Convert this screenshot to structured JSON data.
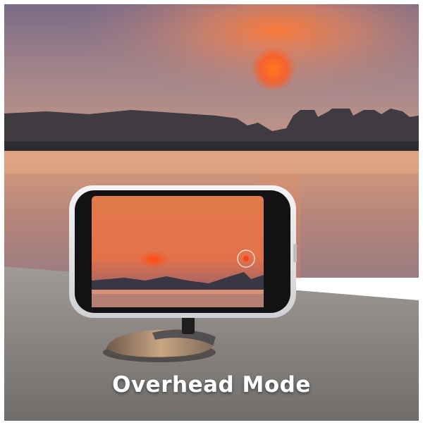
{
  "caption": "Overhead Mode",
  "colors": {
    "sky_top": "#7e6c86",
    "sky_glow": "#f08a53",
    "sun": "#ff5a1e",
    "water": "#c58a6e",
    "ground": "#8f8d8a",
    "phone_case": "#e9e9ea"
  },
  "icons": [
    "shutter-ring-icon"
  ]
}
